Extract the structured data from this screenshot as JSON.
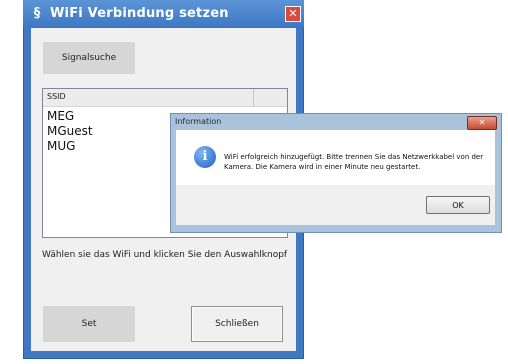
{
  "main_window": {
    "title": "WiFi Verbindung setzen",
    "close_glyph": "✕",
    "signalsuche_label": "Signalsuche",
    "list_header": "SSID",
    "ssid_items": [
      "MEG",
      "MGuest",
      "MUG"
    ],
    "hint_text": "Wählen sie das WiFi und klicken Sie den Auswahlknopf",
    "set_label": "Set",
    "schliessen_label": "Schließen",
    "app_icon": "app-logo-icon"
  },
  "info_dialog": {
    "title": "Information",
    "close_glyph": "✕",
    "icon": "info-icon",
    "icon_glyph": "i",
    "message": "WiFi erfolgreich hinzugefügt. Bitte trennen Sie das Netzwerkkabel von der Kamera. Die Kamera wird in einer Minute neu gestartet.",
    "ok_label": "OK"
  },
  "colors": {
    "window_frame": "#3f79c4",
    "dialog_frame": "#a9c3dd",
    "close_red": "#c74b33"
  }
}
